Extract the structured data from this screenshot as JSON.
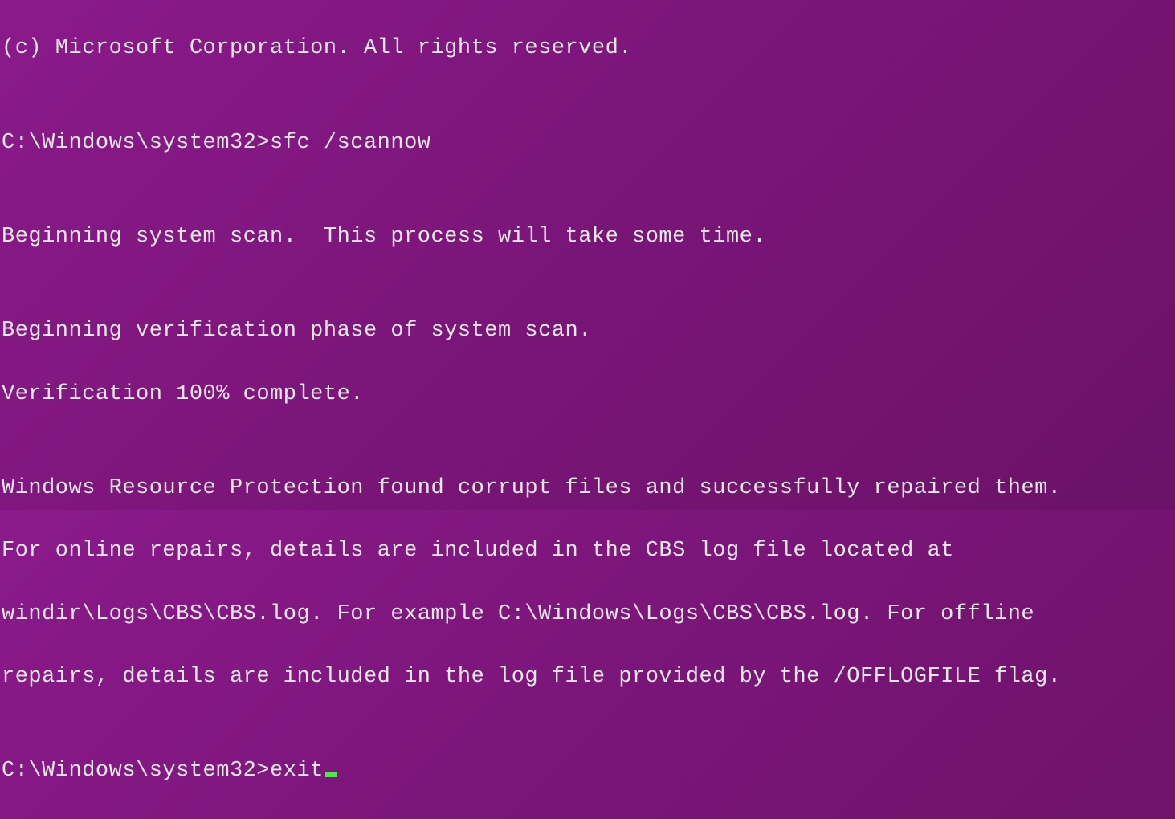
{
  "terminal": {
    "lines": [
      "(c) Microsoft Corporation. All rights reserved.",
      "",
      "C:\\Windows\\system32>sfc /scannow",
      "",
      "Beginning system scan.  This process will take some time.",
      "",
      "Beginning verification phase of system scan.",
      "Verification 100% complete.",
      "",
      "Windows Resource Protection found corrupt files and successfully repaired them.",
      "For online repairs, details are included in the CBS log file located at",
      "windir\\Logs\\CBS\\CBS.log. For example C:\\Windows\\Logs\\CBS\\CBS.log. For offline",
      "repairs, details are included in the log file provided by the /OFFLOGFILE flag.",
      "",
      "C:\\Windows\\system32>exit"
    ],
    "prompt1": "C:\\Windows\\system32>",
    "command1": "sfc /scannow",
    "prompt2": "C:\\Windows\\system32>",
    "command2": "exit",
    "copyright": "(c) Microsoft Corporation. All rights reserved."
  },
  "colors": {
    "background": "#8B1A8B",
    "foreground": "#E8E8E8",
    "cursor": "#4FE34F"
  }
}
